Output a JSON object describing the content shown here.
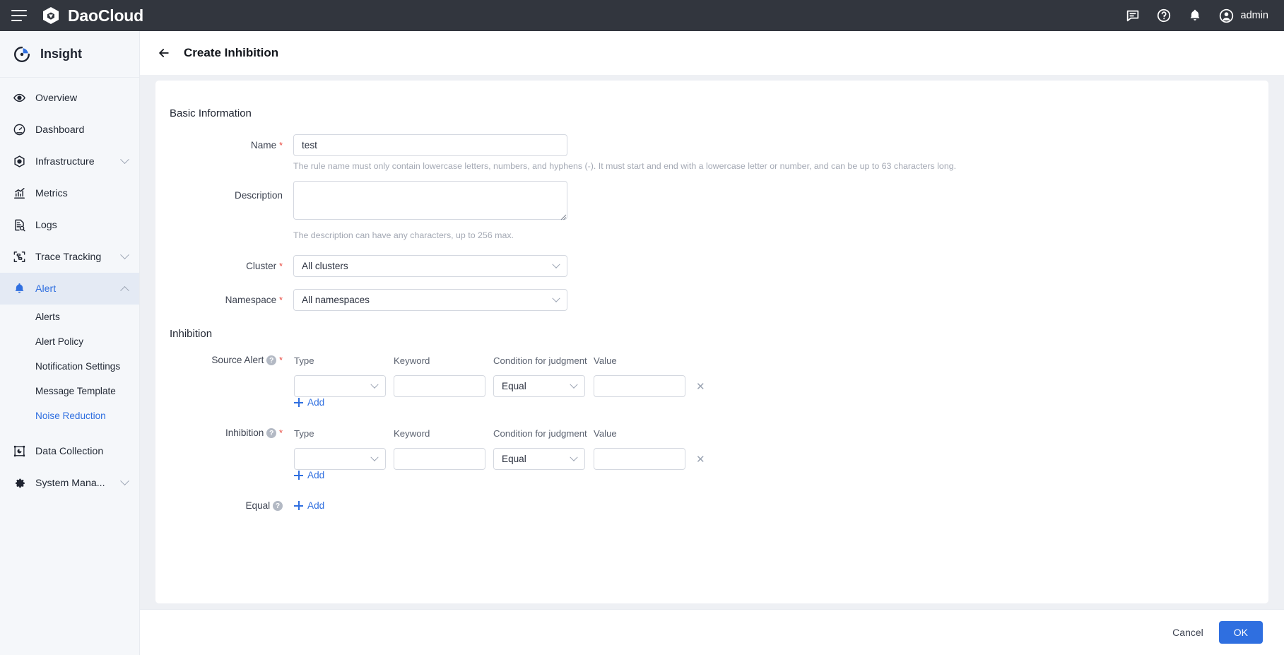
{
  "topbar": {
    "brand": "DaoCloud",
    "menu_icon": "hamburger-icon",
    "icons": [
      "chat-icon",
      "help-icon",
      "bell-icon"
    ],
    "user": "admin"
  },
  "sidebar": {
    "product": "Insight",
    "items": [
      {
        "label": "Overview",
        "icon": "eye-icon",
        "expandable": false,
        "active": false
      },
      {
        "label": "Dashboard",
        "icon": "gauge-icon",
        "expandable": false,
        "active": false
      },
      {
        "label": "Infrastructure",
        "icon": "hexagon-icon",
        "expandable": true,
        "expanded": false,
        "active": false
      },
      {
        "label": "Metrics",
        "icon": "chart-icon",
        "expandable": false,
        "active": false
      },
      {
        "label": "Logs",
        "icon": "log-search-icon",
        "expandable": false,
        "active": false
      },
      {
        "label": "Trace Tracking",
        "icon": "trace-icon",
        "expandable": true,
        "expanded": false,
        "active": false
      },
      {
        "label": "Alert",
        "icon": "bell-icon",
        "expandable": true,
        "expanded": true,
        "active": true
      }
    ],
    "alert_children": [
      {
        "label": "Alerts",
        "active": false
      },
      {
        "label": "Alert Policy",
        "active": false
      },
      {
        "label": "Notification Settings",
        "active": false
      },
      {
        "label": "Message Template",
        "active": false
      },
      {
        "label": "Noise Reduction",
        "active": true
      }
    ],
    "items_bottom": [
      {
        "label": "Data Collection",
        "icon": "data-collection-icon",
        "expandable": false,
        "active": false
      },
      {
        "label": "System Mana...",
        "icon": "gear-icon",
        "expandable": true,
        "expanded": false,
        "active": false
      }
    ]
  },
  "page": {
    "title": "Create Inhibition",
    "back_icon": "back-arrow-icon"
  },
  "basic": {
    "section_title": "Basic Information",
    "name_label": "Name",
    "name_value": "test",
    "name_hint": "The rule name must only contain lowercase letters, numbers, and hyphens (-). It must start and end with a lowercase letter or number, and can be up to 63 characters long.",
    "description_label": "Description",
    "description_value": "",
    "description_hint": "The description can have any characters, up to 256 max.",
    "cluster_label": "Cluster",
    "cluster_value": "All clusters",
    "namespace_label": "Namespace",
    "namespace_value": "All namespaces"
  },
  "inhibition": {
    "section_title": "Inhibition",
    "columns": {
      "type": "Type",
      "keyword": "Keyword",
      "condition": "Condition for judgment",
      "value": "Value"
    },
    "add_label": "Add",
    "groups": [
      {
        "label": "Source Alert",
        "required": true,
        "has_help": true,
        "rows": [
          {
            "type": "",
            "keyword": "",
            "condition": "Equal",
            "value": "",
            "delete_icon": "close-icon"
          }
        ]
      },
      {
        "label": "Inhibition",
        "required": true,
        "has_help": true,
        "rows": [
          {
            "type": "",
            "keyword": "",
            "condition": "Equal",
            "value": "",
            "delete_icon": "close-icon"
          }
        ]
      }
    ],
    "equal_group": {
      "label": "Equal",
      "required": false,
      "has_help": true,
      "add_label": "Add"
    }
  },
  "footer": {
    "cancel_label": "Cancel",
    "ok_label": "OK"
  },
  "colors": {
    "accent": "#2f6fe0",
    "topbar_bg": "#32363e",
    "sidebar_bg": "#f5f7fa",
    "content_bg": "#eef0f4",
    "required": "#e8483f"
  }
}
